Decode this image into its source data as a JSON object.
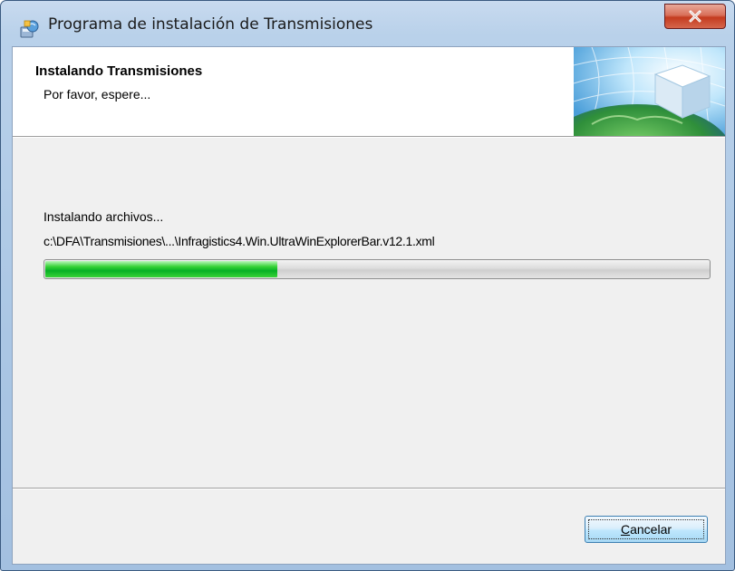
{
  "window": {
    "title": "Programa de instalación de Transmisiones",
    "close_icon": "close-icon",
    "app_icon": "installer-icon"
  },
  "header": {
    "title": "Instalando Transmisiones",
    "subtitle": "Por favor, espere...",
    "image_icon": "globe-cube-graphic"
  },
  "main": {
    "status_label": "Instalando archivos...",
    "file_path": "c:\\DFA\\Transmisiones\\...\\Infragistics4.Win.UltraWinExplorerBar.v12.1.xml",
    "progress_fraction": 0.35
  },
  "footer": {
    "cancel_mnemonic": "C",
    "cancel_rest": "ancelar"
  },
  "colors": {
    "progress_green": "#06b025",
    "close_red": "#c43b1f",
    "titlebar_blue": "#b9d1ea"
  }
}
